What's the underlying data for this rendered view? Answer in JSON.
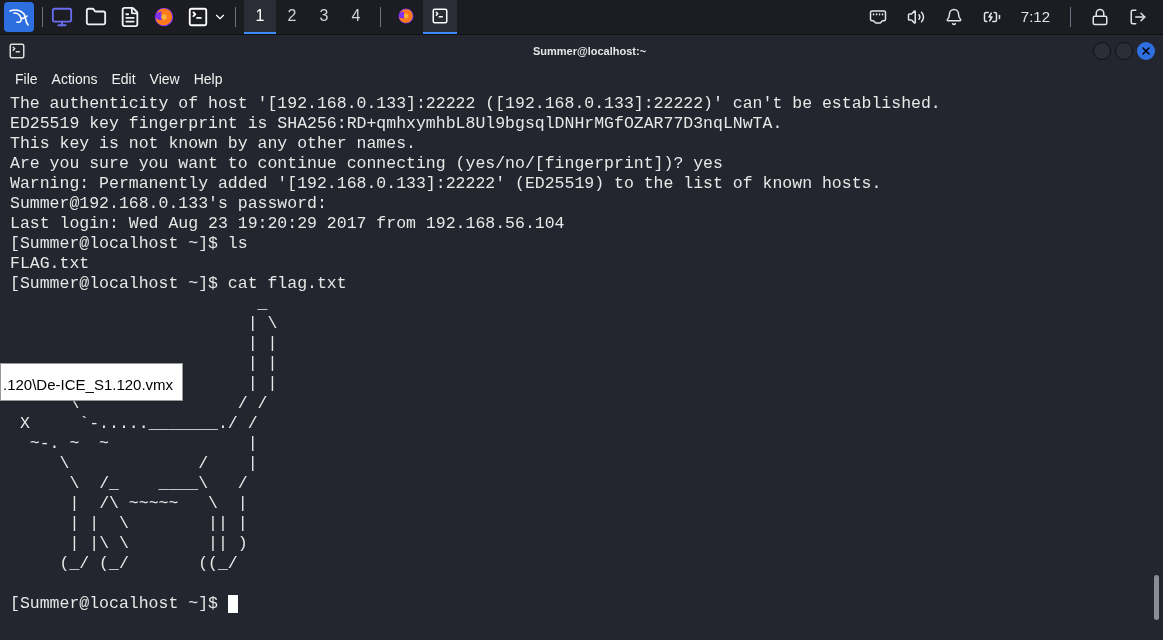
{
  "taskbar": {
    "workspaces": [
      {
        "label": "1",
        "selected": true
      },
      {
        "label": "2",
        "selected": false
      },
      {
        "label": "3",
        "selected": false
      },
      {
        "label": "4",
        "selected": false
      }
    ],
    "windows": [
      {
        "kind": "browser",
        "selected": false
      },
      {
        "kind": "terminal",
        "selected": true
      }
    ],
    "clock": "7:12"
  },
  "terminal": {
    "title": "Summer@localhost:~",
    "menu": [
      "File",
      "Actions",
      "Edit",
      "View",
      "Help"
    ],
    "lines": [
      "The authenticity of host '[192.168.0.133]:22222 ([192.168.0.133]:22222)' can't be established.",
      "ED25519 key fingerprint is SHA256:RD+qmhxymhbL8Ul9bgsqlDNHrMGfOZAR77D3nqLNwTA.",
      "This key is not known by any other names.",
      "Are you sure you want to continue connecting (yes/no/[fingerprint])? yes",
      "Warning: Permanently added '[192.168.0.133]:22222' (ED25519) to the list of known hosts.",
      "Summer@192.168.0.133's password:",
      "Last login: Wed Aug 23 19:20:29 2017 from 192.168.56.104",
      "[Summer@localhost ~]$ ls",
      "FLAG.txt",
      "[Summer@localhost ~]$ cat flag.txt"
    ],
    "art": [
      "                         _",
      "                        | \\",
      "                        | |",
      "                        | |",
      "                        | |",
      "      \\                / /",
      " X     `-....._______./ /",
      "  ~-. ~  ~              |",
      "     \\             /    |",
      "      \\  /_    ____\\   /",
      "      |  /\\ ~~~~~   \\  |",
      "      | |  \\        || |",
      "      | |\\ \\        || )",
      "     (_/ (_/       ((_/"
    ],
    "prompt": "[Summer@localhost ~]$"
  },
  "tooltip": {
    "text": ".120\\De-ICE_S1.120.vmx"
  }
}
